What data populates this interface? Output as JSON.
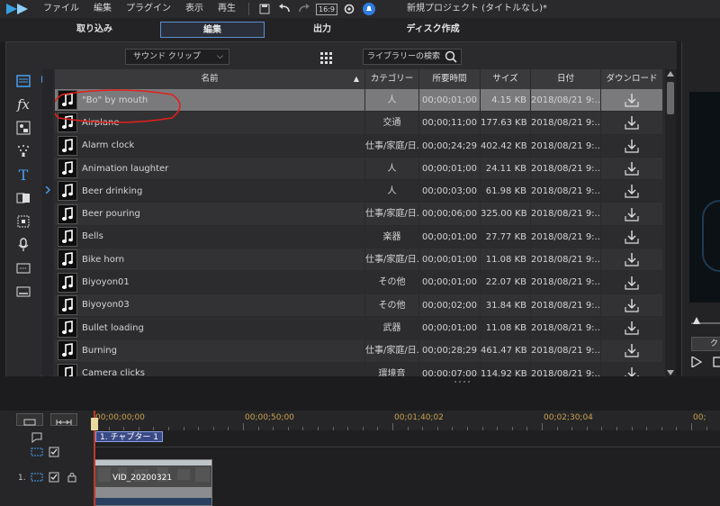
{
  "menubar": {
    "items": [
      "ファイル",
      "編集",
      "プラグイン",
      "表示",
      "再生"
    ],
    "aspect_ratio": "16:9",
    "project_title": "新規プロジェクト (タイトルなし)*"
  },
  "modes": {
    "tabs": [
      {
        "label": "取り込み"
      },
      {
        "label": "編集"
      },
      {
        "label": "出力"
      },
      {
        "label": "ディスク作成"
      }
    ],
    "active": "編集"
  },
  "library": {
    "dropdown": {
      "value": "サウンド クリップ"
    },
    "search": {
      "placeholder": "ライブラリーの検索"
    },
    "columns": [
      "名前",
      "カテゴリー",
      "所要時間",
      "サイズ",
      "日付",
      "ダウンロード"
    ],
    "rows": [
      {
        "name": "\"Bo\" by mouth",
        "category": "人",
        "duration": "00;00;01;00",
        "size": "4.15 KB",
        "date": "2018/08/21 9:..."
      },
      {
        "name": "Airplane",
        "category": "交通",
        "duration": "00;00;11;00",
        "size": "177.63 KB",
        "date": "2018/08/21 9:..."
      },
      {
        "name": "Alarm clock",
        "category": "仕事/家庭/日...",
        "duration": "00;00;24;29",
        "size": "402.42 KB",
        "date": "2018/08/21 9:..."
      },
      {
        "name": "Animation laughter",
        "category": "人",
        "duration": "00;00;01;00",
        "size": "24.11 KB",
        "date": "2018/08/21 9:..."
      },
      {
        "name": "Beer drinking",
        "category": "人",
        "duration": "00;00;03;00",
        "size": "61.98 KB",
        "date": "2018/08/21 9:..."
      },
      {
        "name": "Beer pouring",
        "category": "仕事/家庭/日...",
        "duration": "00;00;06;00",
        "size": "325.00 KB",
        "date": "2018/08/21 9:..."
      },
      {
        "name": "Bells",
        "category": "楽器",
        "duration": "00;00;01;00",
        "size": "27.77 KB",
        "date": "2018/08/21 9:..."
      },
      {
        "name": "Bike horn",
        "category": "仕事/家庭/日...",
        "duration": "00;00;01;00",
        "size": "11.08 KB",
        "date": "2018/08/21 9:..."
      },
      {
        "name": "Biyoyon01",
        "category": "その他",
        "duration": "00;00;01;00",
        "size": "22.07 KB",
        "date": "2018/08/21 9:..."
      },
      {
        "name": "Biyoyon03",
        "category": "その他",
        "duration": "00;00;02;00",
        "size": "31.84 KB",
        "date": "2018/08/21 9:..."
      },
      {
        "name": "Bullet loading",
        "category": "武器",
        "duration": "00;00;01;00",
        "size": "11.08 KB",
        "date": "2018/08/21 9:..."
      },
      {
        "name": "Burning",
        "category": "仕事/家庭/日...",
        "duration": "00;00;28;29",
        "size": "461.47 KB",
        "date": "2018/08/21 9:..."
      },
      {
        "name": "Camera clicks",
        "category": "環境音",
        "duration": "00;00;07;00",
        "size": "114.92 KB",
        "date": "2018/08/21 9:..."
      }
    ]
  },
  "preview": {
    "button_label": "ク"
  },
  "timeline": {
    "timecodes": [
      "00;00;00;00",
      "00;00;50;00",
      "00;01;40;02",
      "00;02;30;04",
      "00;"
    ],
    "chapter_label": "1. チャプター 1",
    "track_number": "1.",
    "clip_label": "VID_20200321"
  },
  "colors": {
    "accent": "#5f8fd0",
    "selected_row": "#7a7a7c",
    "annotation_circle": "#e0201a",
    "playhead": "#c0392b"
  }
}
